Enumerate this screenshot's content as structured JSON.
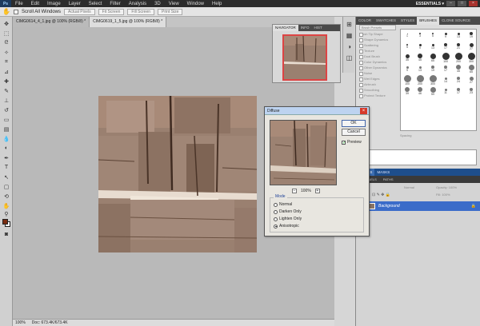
{
  "menubar": {
    "logo": "Ps",
    "items": [
      "File",
      "Edit",
      "Image",
      "Layer",
      "Select",
      "Filter",
      "Analysis",
      "3D",
      "View",
      "Window",
      "Help"
    ],
    "workspace": "ESSENTIALS ▾"
  },
  "optionsbar": {
    "scroll_all": "Scroll All Windows",
    "buttons": [
      "Actual Pixels",
      "Fit Screen",
      "Fill Screen",
      "Print Size"
    ]
  },
  "doctabs": [
    "CIMG0614_4_1.jpg @ 100% (RGB/8) *",
    "CIMG0619_1_5.jpg @ 100% (RGB/8) *"
  ],
  "status": {
    "zoom": "100%",
    "doc": "Doc: 673.4K/673.4K"
  },
  "navigator": {
    "tabs": [
      "NAVIGATOR",
      "INFO",
      "HIST"
    ]
  },
  "brushes": {
    "tabs": [
      "COLOR",
      "SWATCHES",
      "STYLES",
      "BRUSHES",
      "CLONE SOURCE"
    ],
    "presets_label": "Brush Presets",
    "tip_label": "Brush Tip Shape",
    "options": [
      "Shape Dynamics",
      "Scattering",
      "Texture",
      "Dual Brush",
      "Color Dynamics",
      "Other Dynamics",
      "Noise",
      "Wet Edges",
      "Airbrush",
      "Smoothing",
      "Protect Texture"
    ],
    "sizes": [
      1,
      3,
      5,
      9,
      13,
      19,
      5,
      9,
      13,
      17,
      21,
      27,
      35,
      45,
      65,
      100,
      200,
      300,
      9,
      13,
      19,
      17,
      45,
      65,
      100,
      200,
      300,
      14,
      24,
      27,
      39,
      46,
      59,
      11,
      17,
      23
    ],
    "spacing_label": "Spacing"
  },
  "layers": {
    "tabs": [
      "LAYERS",
      "MASKS"
    ],
    "subtabs": [
      "CHANNELS",
      "PATHS"
    ],
    "blend": "Normal",
    "opacity": "Opacity: 100%",
    "fill": "Fill: 100%",
    "layer_name": "Background"
  },
  "dialog": {
    "title": "Diffuse",
    "ok": "OK",
    "cancel": "Cancel",
    "preview_label": "Preview",
    "zoom": "100%",
    "mode_label": "Mode",
    "modes": [
      "Normal",
      "Darken Only",
      "Lighten Only",
      "Anisotropic"
    ],
    "selected_mode": "Anisotropic"
  }
}
